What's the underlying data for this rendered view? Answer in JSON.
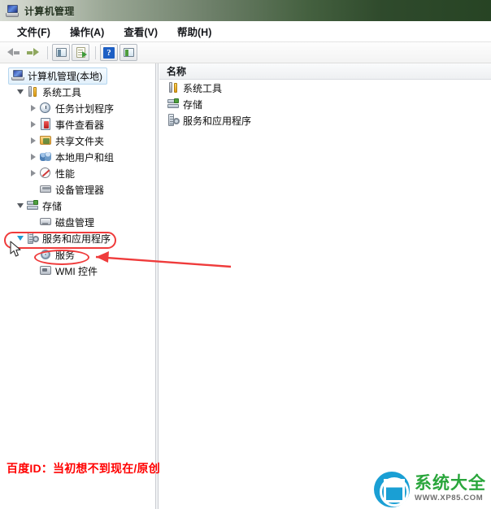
{
  "window": {
    "title": "计算机管理",
    "icon": "computer-management-icon"
  },
  "menubar": {
    "items": [
      {
        "label": "文件(F)",
        "name": "menu-file"
      },
      {
        "label": "操作(A)",
        "name": "menu-action"
      },
      {
        "label": "查看(V)",
        "name": "menu-view"
      },
      {
        "label": "帮助(H)",
        "name": "menu-help"
      }
    ]
  },
  "toolbar": {
    "buttons": [
      {
        "name": "back-arrow-icon",
        "icon": "arrow-left"
      },
      {
        "name": "forward-arrow-icon",
        "icon": "arrow-right"
      },
      {
        "name": "show-hide-console-tree-button",
        "icon": "window-pane-icon"
      },
      {
        "name": "export-list-button",
        "icon": "document-export-icon"
      },
      {
        "name": "help-button",
        "icon": "question-mark-icon"
      },
      {
        "name": "show-action-pane-button",
        "icon": "window-pane-green-icon"
      }
    ]
  },
  "tree": {
    "root": {
      "label": "计算机管理(本地)",
      "icon": "computer-management-icon",
      "selected": true
    },
    "nodes": [
      {
        "label": "系统工具",
        "icon": "system-tools-icon",
        "indent": 1,
        "twist": "open"
      },
      {
        "label": "任务计划程序",
        "icon": "task-scheduler-clock-icon",
        "indent": 2,
        "twist": "closed"
      },
      {
        "label": "事件查看器",
        "icon": "event-viewer-icon",
        "indent": 2,
        "twist": "closed"
      },
      {
        "label": "共享文件夹",
        "icon": "shared-folders-icon",
        "indent": 2,
        "twist": "closed"
      },
      {
        "label": "本地用户和组",
        "icon": "local-users-groups-icon",
        "indent": 2,
        "twist": "closed"
      },
      {
        "label": "性能",
        "icon": "performance-icon",
        "indent": 2,
        "twist": "closed"
      },
      {
        "label": "设备管理器",
        "icon": "device-manager-icon",
        "indent": 2,
        "twist": "none"
      },
      {
        "label": "存储",
        "icon": "storage-icon",
        "indent": 1,
        "twist": "open"
      },
      {
        "label": "磁盘管理",
        "icon": "disk-management-icon",
        "indent": 2,
        "twist": "none"
      },
      {
        "label": "服务和应用程序",
        "icon": "services-applications-icon",
        "indent": 1,
        "twist": "open-blue",
        "highlight": "rectangle"
      },
      {
        "label": "服务",
        "icon": "services-gear-icon",
        "indent": 2,
        "twist": "none",
        "highlight": "ellipse"
      },
      {
        "label": "WMI 控件",
        "icon": "wmi-control-icon",
        "indent": 2,
        "twist": "none"
      }
    ]
  },
  "list": {
    "column_header": "名称",
    "rows": [
      {
        "label": "系统工具",
        "icon": "system-tools-icon"
      },
      {
        "label": "存储",
        "icon": "storage-icon"
      },
      {
        "label": "服务和应用程序",
        "icon": "services-applications-icon"
      }
    ]
  },
  "annotations": {
    "color": "#ef3b3b",
    "rect_target": "服务和应用程序",
    "ellipse_target": "服务",
    "arrow": "points-left-to-服务",
    "cursor": "mouse-pointer"
  },
  "watermark": {
    "text": "百度ID：当初想不到现在/原创",
    "color": "#ff0000"
  },
  "logo": {
    "name_cn": "系统大全",
    "url": "WWW.XP85.COM",
    "mark_color": "#1a9fd4",
    "text_color": "#2aa63c"
  }
}
